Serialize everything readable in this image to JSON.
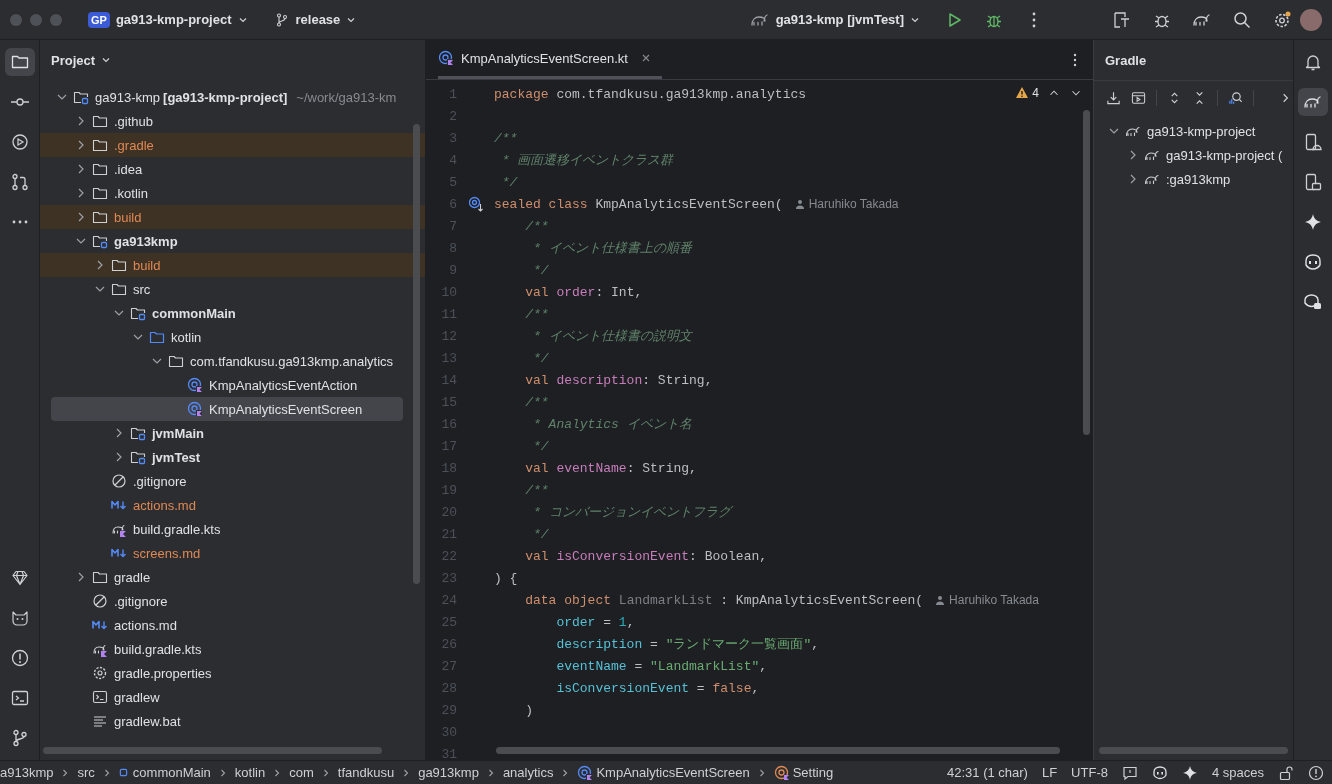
{
  "title_bar": {
    "project_badge": "GP",
    "project": "ga913-kmp-project",
    "branch": "release",
    "run_config": "ga913-kmp [jvmTest]"
  },
  "left_tools": [
    {
      "kind": "project",
      "selected": true
    },
    {
      "kind": "commit",
      "selected": false
    },
    {
      "kind": "services",
      "selected": false
    },
    {
      "kind": "pull-requests",
      "selected": false
    },
    {
      "kind": "more",
      "selected": false
    }
  ],
  "left_tools_bottom": [
    {
      "kind": "gem",
      "selected": false
    },
    {
      "kind": "cat",
      "selected": false
    },
    {
      "kind": "problems",
      "selected": false
    },
    {
      "kind": "terminal",
      "selected": false
    },
    {
      "kind": "git",
      "selected": false
    }
  ],
  "project_panel": {
    "title": "Project",
    "tree": [
      {
        "label": "ga913-kmp",
        "module": "[ga913-kmp-project]",
        "path": "~/work/ga913-km",
        "kind": "module",
        "expanded": true,
        "excluded": false,
        "modified": false,
        "selected": false,
        "children": [
          {
            "label": ".github",
            "kind": "folder",
            "expanded": false,
            "excluded": false,
            "modified": false,
            "selected": false
          },
          {
            "label": ".gradle",
            "kind": "folder",
            "expanded": false,
            "excluded": true,
            "modified": false,
            "selected": false
          },
          {
            "label": ".idea",
            "kind": "folder",
            "expanded": false,
            "excluded": false,
            "modified": false,
            "selected": false
          },
          {
            "label": ".kotlin",
            "kind": "folder",
            "expanded": false,
            "excluded": false,
            "modified": false,
            "selected": false
          },
          {
            "label": "build",
            "kind": "folder",
            "expanded": false,
            "excluded": true,
            "modified": false,
            "selected": false
          },
          {
            "label": "ga913kmp",
            "kind": "module",
            "bold": true,
            "expanded": true,
            "excluded": false,
            "modified": false,
            "selected": false,
            "children": [
              {
                "label": "build",
                "kind": "folder",
                "expanded": false,
                "excluded": true,
                "modified": false,
                "selected": false
              },
              {
                "label": "src",
                "kind": "folder",
                "expanded": true,
                "excluded": false,
                "modified": false,
                "selected": false,
                "children": [
                  {
                    "label": "commonMain",
                    "kind": "module",
                    "bold": true,
                    "expanded": true,
                    "excluded": false,
                    "modified": false,
                    "selected": false,
                    "children": [
                      {
                        "label": "kotlin",
                        "kind": "source",
                        "expanded": true,
                        "excluded": false,
                        "modified": false,
                        "selected": false,
                        "children": [
                          {
                            "label": "com.tfandkusu.ga913kmp.analytics",
                            "kind": "folder",
                            "expanded": true,
                            "excluded": false,
                            "modified": false,
                            "selected": false,
                            "children": [
                              {
                                "label": "KmpAnalyticsEventAction",
                                "kind": "class",
                                "excluded": false,
                                "modified": false,
                                "selected": false
                              },
                              {
                                "label": "KmpAnalyticsEventScreen",
                                "kind": "class",
                                "excluded": false,
                                "modified": false,
                                "selected": true
                              }
                            ]
                          }
                        ]
                      }
                    ]
                  },
                  {
                    "label": "jvmMain",
                    "kind": "module",
                    "bold": true,
                    "expanded": false,
                    "excluded": false,
                    "modified": false,
                    "selected": false
                  },
                  {
                    "label": "jvmTest",
                    "kind": "module",
                    "bold": true,
                    "expanded": false,
                    "excluded": false,
                    "modified": false,
                    "selected": false
                  }
                ]
              },
              {
                "label": ".gitignore",
                "kind": "ignore",
                "excluded": false,
                "modified": false,
                "selected": false
              },
              {
                "label": "actions.md",
                "kind": "markdown",
                "excluded": false,
                "modified": true,
                "selected": false
              },
              {
                "label": "build.gradle.kts",
                "kind": "gradle",
                "excluded": false,
                "modified": false,
                "selected": false
              },
              {
                "label": "screens.md",
                "kind": "markdown",
                "excluded": false,
                "modified": true,
                "selected": false
              }
            ]
          },
          {
            "label": "gradle",
            "kind": "folder",
            "expanded": false,
            "excluded": false,
            "modified": false,
            "selected": false
          },
          {
            "label": ".gitignore",
            "kind": "ignore",
            "excluded": false,
            "modified": false,
            "selected": false
          },
          {
            "label": "actions.md",
            "kind": "markdown",
            "excluded": false,
            "modified": false,
            "selected": false
          },
          {
            "label": "build.gradle.kts",
            "kind": "gradle",
            "excluded": false,
            "modified": false,
            "selected": false
          },
          {
            "label": "gradle.properties",
            "kind": "settings",
            "excluded": false,
            "modified": false,
            "selected": false
          },
          {
            "label": "gradlew",
            "kind": "terminal",
            "excluded": false,
            "modified": false,
            "selected": false
          },
          {
            "label": "gradlew.bat",
            "kind": "text",
            "excluded": false,
            "modified": false,
            "selected": false
          }
        ]
      }
    ]
  },
  "editor": {
    "tabs": [
      {
        "label": "KmpAnalyticsEventScreen.kt",
        "selected": true
      }
    ],
    "warnings": "4",
    "lines": [
      {
        "number": "1",
        "tokens": [
          {
            "kind": "kw",
            "text": "package"
          },
          {
            "kind": "plain",
            "text": " com.tfandkusu.ga913kmp.analytics"
          }
        ]
      },
      {
        "number": "2"
      },
      {
        "number": "3",
        "tokens": [
          {
            "kind": "doc",
            "text": "/**"
          }
        ]
      },
      {
        "number": "4",
        "tokens": [
          {
            "kind": "doc",
            "text": " * 画面遷移イベントクラス群"
          }
        ]
      },
      {
        "number": "5",
        "tokens": [
          {
            "kind": "doc",
            "text": " */"
          }
        ]
      },
      {
        "number": "6",
        "implemented": true,
        "author": "Haruhiko Takada",
        "tokens": [
          {
            "kind": "kw",
            "text": "sealed class"
          },
          {
            "kind": "plain",
            "text": " KmpAnalyticsEventScreen("
          }
        ]
      },
      {
        "number": "7",
        "tokens": [
          {
            "kind": "doc",
            "text": "    /**"
          }
        ]
      },
      {
        "number": "8",
        "tokens": [
          {
            "kind": "doc",
            "text": "     * イベント仕様書上の順番"
          }
        ]
      },
      {
        "number": "9",
        "tokens": [
          {
            "kind": "doc",
            "text": "     */"
          }
        ]
      },
      {
        "number": "10",
        "tokens": [
          {
            "kind": "kw",
            "text": "    val"
          },
          {
            "kind": "prop",
            "text": " order"
          },
          {
            "kind": "plain",
            "text": ": Int,"
          }
        ]
      },
      {
        "number": "11",
        "tokens": [
          {
            "kind": "doc",
            "text": "    /**"
          }
        ]
      },
      {
        "number": "12",
        "tokens": [
          {
            "kind": "doc",
            "text": "     * イベント仕様書の説明文"
          }
        ]
      },
      {
        "number": "13",
        "tokens": [
          {
            "kind": "doc",
            "text": "     */"
          }
        ]
      },
      {
        "number": "14",
        "tokens": [
          {
            "kind": "kw",
            "text": "    val"
          },
          {
            "kind": "prop",
            "text": " description"
          },
          {
            "kind": "plain",
            "text": ": String,"
          }
        ]
      },
      {
        "number": "15",
        "tokens": [
          {
            "kind": "doc",
            "text": "    /**"
          }
        ]
      },
      {
        "number": "16",
        "tokens": [
          {
            "kind": "doc",
            "text": "     * Analytics イベント名"
          }
        ]
      },
      {
        "number": "17",
        "tokens": [
          {
            "kind": "doc",
            "text": "     */"
          }
        ]
      },
      {
        "number": "18",
        "tokens": [
          {
            "kind": "kw",
            "text": "    val"
          },
          {
            "kind": "prop",
            "text": " eventName"
          },
          {
            "kind": "plain",
            "text": ": String,"
          }
        ]
      },
      {
        "number": "19",
        "tokens": [
          {
            "kind": "doc",
            "text": "    /**"
          }
        ]
      },
      {
        "number": "20",
        "tokens": [
          {
            "kind": "doc",
            "text": "     * コンバージョンイベントフラグ"
          }
        ]
      },
      {
        "number": "21",
        "tokens": [
          {
            "kind": "doc",
            "text": "     */"
          }
        ]
      },
      {
        "number": "22",
        "tokens": [
          {
            "kind": "kw",
            "text": "    val"
          },
          {
            "kind": "prop",
            "text": " isConversionEvent"
          },
          {
            "kind": "plain",
            "text": ": Boolean,"
          }
        ]
      },
      {
        "number": "23",
        "tokens": [
          {
            "kind": "plain",
            "text": ") {"
          }
        ]
      },
      {
        "number": "24",
        "author": "Haruhiko Takada",
        "tokens": [
          {
            "kind": "kw",
            "text": "    data object"
          },
          {
            "kind": "dim",
            "text": " LandmarkList"
          },
          {
            "kind": "plain",
            "text": " : KmpAnalyticsEventScreen("
          }
        ]
      },
      {
        "number": "25",
        "tokens": [
          {
            "kind": "arg",
            "text": "        order"
          },
          {
            "kind": "plain",
            "text": " = "
          },
          {
            "kind": "num",
            "text": "1"
          },
          {
            "kind": "plain",
            "text": ","
          }
        ]
      },
      {
        "number": "26",
        "tokens": [
          {
            "kind": "arg",
            "text": "        description"
          },
          {
            "kind": "plain",
            "text": " = "
          },
          {
            "kind": "str",
            "text": "\"ランドマーク一覧画面\""
          },
          {
            "kind": "plain",
            "text": ","
          }
        ]
      },
      {
        "number": "27",
        "tokens": [
          {
            "kind": "arg",
            "text": "        eventName"
          },
          {
            "kind": "plain",
            "text": " = "
          },
          {
            "kind": "str",
            "text": "\"LandmarkList\""
          },
          {
            "kind": "plain",
            "text": ","
          }
        ]
      },
      {
        "number": "28",
        "tokens": [
          {
            "kind": "arg",
            "text": "        isConversionEvent"
          },
          {
            "kind": "plain",
            "text": " = "
          },
          {
            "kind": "kw",
            "text": "false"
          },
          {
            "kind": "plain",
            "text": ","
          }
        ]
      },
      {
        "number": "29",
        "tokens": [
          {
            "kind": "plain",
            "text": "    )"
          }
        ]
      },
      {
        "number": "30"
      },
      {
        "number": "31"
      }
    ]
  },
  "gradle_panel": {
    "title": "Gradle",
    "tree": [
      {
        "label": "ga913-kmp-project",
        "expanded": true,
        "children": [
          {
            "label": "ga913-kmp-project (",
            "expanded": false
          },
          {
            "label": ":ga913kmp",
            "expanded": false
          }
        ]
      }
    ]
  },
  "right_tools": [
    {
      "kind": "notifications",
      "selected": false
    },
    {
      "kind": "gradle",
      "selected": true
    },
    {
      "kind": "device",
      "selected": false
    },
    {
      "kind": "device-mirror",
      "selected": false
    },
    {
      "kind": "ai",
      "selected": false
    },
    {
      "kind": "copilot",
      "selected": false
    },
    {
      "kind": "copilot-chat",
      "selected": false
    }
  ],
  "status_bar": {
    "breadcrumbs": [
      {
        "label": "a913kmp"
      },
      {
        "label": "src"
      },
      {
        "label": "commonMain",
        "kind": "module"
      },
      {
        "label": "kotlin"
      },
      {
        "label": "com"
      },
      {
        "label": "tfandkusu"
      },
      {
        "label": "ga913kmp"
      },
      {
        "label": "analytics"
      },
      {
        "label": "KmpAnalyticsEventScreen",
        "kind": "class"
      },
      {
        "label": "Setting",
        "kind": "object"
      }
    ],
    "position": "42:31 (1 char)",
    "line_separator": "LF",
    "encoding": "UTF-8",
    "indent": "4 spaces"
  }
}
